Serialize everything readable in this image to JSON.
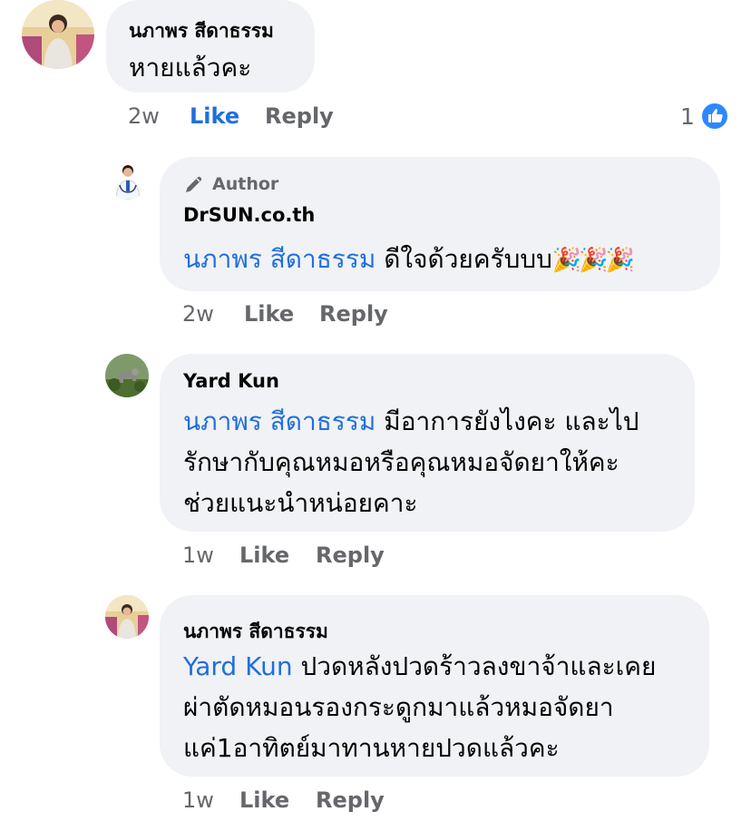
{
  "comments": [
    {
      "author": "นภาพร สีดาธรรม",
      "text": "หายแล้วคะ",
      "time": "2w",
      "like_label": "Like",
      "reply_label": "Reply",
      "reaction_count": "1"
    },
    {
      "badge_label": "Author",
      "author": "DrSUN.co.th",
      "mention": "นภาพร สีดาธรรม",
      "text": " ดีใจด้วยครับบบ",
      "emoji": "🎉🎉🎉",
      "time": "2w",
      "like_label": "Like",
      "reply_label": "Reply"
    },
    {
      "author": "Yard Kun",
      "mention": "นภาพร สีดาธรรม",
      "line1": " มีอาการยังไงคะ  และไป",
      "line2": "รักษากับคุณหมอหรือคุณหมอจัดยาให้คะ",
      "line3": "ช่วยแนะนำหน่อยคาะ",
      "time": "1w",
      "like_label": "Like",
      "reply_label": "Reply"
    },
    {
      "author": "นภาพร สีดาธรรม",
      "mention": "Yard Kun",
      "line1": " ปวดหลังปวดร้าวลงขาจ้าและเคย",
      "line2": "ผ่าตัดหมอนรองกระดูกมาแล้วหมอจัดยา",
      "line3": "แค่1อาทิตย์มาทานหายปวดแล้วคะ",
      "time": "1w",
      "like_label": "Like",
      "reply_label": "Reply"
    }
  ],
  "colors": {
    "bubble": "#f0f2f5",
    "link": "#216fdb",
    "muted": "#65676b"
  },
  "icons": [
    "pencil-icon",
    "like-reaction-icon"
  ]
}
